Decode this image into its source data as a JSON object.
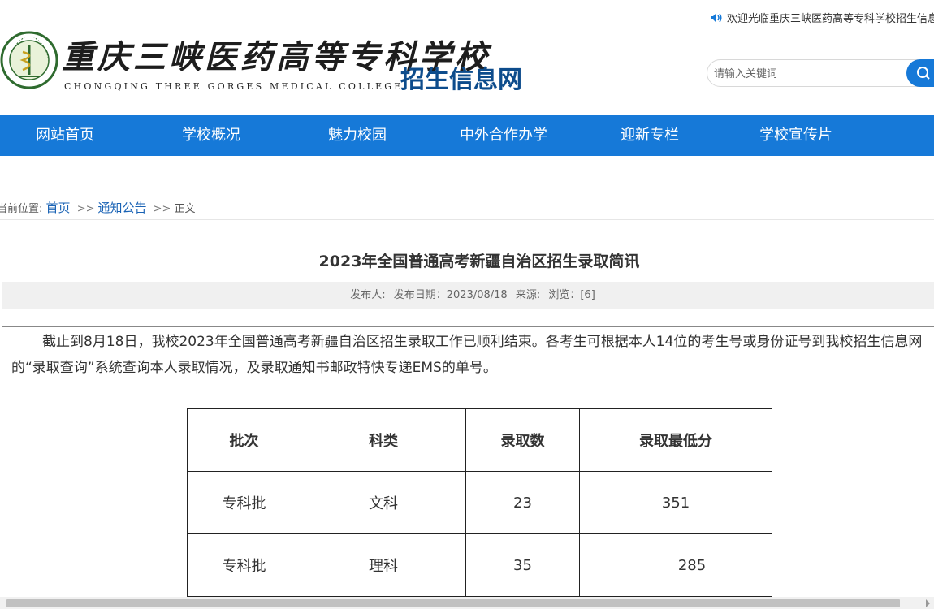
{
  "header": {
    "school_name_cn": "重庆三峡医药高等专科学校",
    "school_name_en": "CHONGQING THREE GORGES MEDICAL COLLEGE",
    "site_title": "招生信息网",
    "welcome": "欢迎光临重庆三峡医药高等专科学校招生信息网",
    "search_placeholder": "请输入关键词"
  },
  "nav": {
    "items": [
      {
        "label": "网站首页"
      },
      {
        "label": "学校概况"
      },
      {
        "label": "魅力校园"
      },
      {
        "label": "中外合作办学"
      },
      {
        "label": "迎新专栏"
      },
      {
        "label": "学校宣传片"
      }
    ]
  },
  "breadcrumb": {
    "prefix": "当前位置:",
    "home": "首页",
    "sep": ">>",
    "section": "通知公告",
    "current": "正文"
  },
  "article": {
    "title": "2023年全国普通高考新疆自治区招生录取简讯",
    "meta": {
      "publisher": "发布人:",
      "date": "发布日期：2023/08/18",
      "source": "来源:",
      "views": "浏览：[6]"
    },
    "paragraph": "截止到8月18日，我校2023年全国普通高考新疆自治区招生录取工作已顺利结束。各考生可根据本人14位的考生号或身份证号到我校招生信息网的“录取查询”系统查询本人录取情况，及录取通知书邮政特快专递EMS的单号。"
  },
  "table": {
    "headers": [
      "批次",
      "科类",
      "录取数",
      "录取最低分"
    ],
    "rows": [
      [
        "专科批",
        "文科",
        "23",
        "351"
      ],
      [
        "专科批",
        "理科",
        "35",
        "285"
      ]
    ]
  },
  "colors": {
    "nav_bg": "#1679d8",
    "title_blue": "#0d4c8c",
    "link_blue": "#1a63b5"
  }
}
